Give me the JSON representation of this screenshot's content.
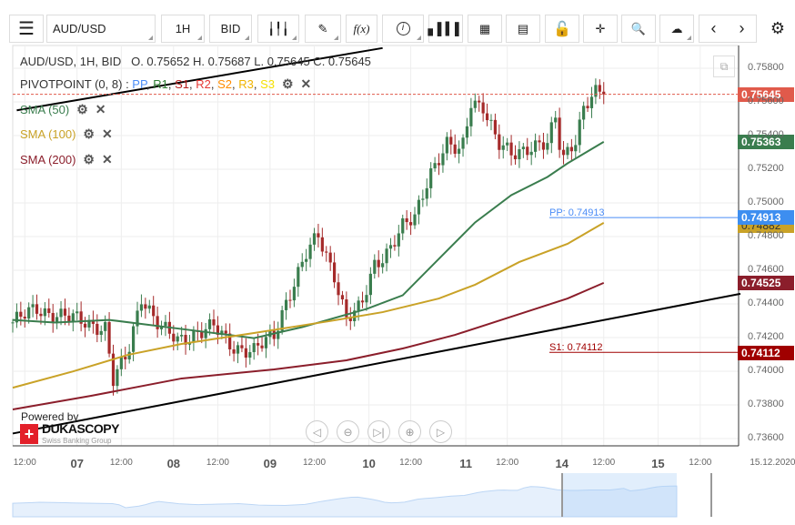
{
  "toolbar": {
    "menu_icon": "hamburger-icon",
    "instrument": "AUD/USD",
    "period": "1H",
    "side": "BID",
    "buttons": [
      "candles-icon",
      "pencil-icon",
      "function-icon",
      "info-icon",
      "volume-bars-icon",
      "calendar-icon",
      "report-icon",
      "lock-icon",
      "crosshair-icon",
      "zoom-chart-icon",
      "cloud-upload-icon",
      "prev-icon",
      "next-icon",
      "gear-icon"
    ],
    "fx_label": "f(x)"
  },
  "legend": {
    "ohlc": "AUD/USD, 1H, BID",
    "ohlc_values": "O. 0.75652 H. 0.75687 L. 0.75645 C. 0.75645",
    "pivot": "PIVOTPOINT (0, 8)",
    "pivot_colon": " : ",
    "pivot_items": [
      {
        "t": "PP",
        "c": "#4a8cf7"
      },
      {
        "t": "R1",
        "c": "#2e7d32"
      },
      {
        "t": "S1",
        "c": "#b71c1c"
      },
      {
        "t": "R2",
        "c": "#e53935"
      },
      {
        "t": "S2",
        "c": "#ff8c00"
      },
      {
        "t": "R3",
        "c": "#f0b400"
      },
      {
        "t": "S3",
        "c": "#f5e000"
      }
    ],
    "sma": [
      {
        "label": "SMA (50)",
        "color": "#3a7d4e"
      },
      {
        "label": "SMA (100)",
        "color": "#c9a227"
      },
      {
        "label": "SMA (200)",
        "color": "#8b1e2b"
      }
    ]
  },
  "price_labels": {
    "last": "0.75645",
    "sma50": "0.75363",
    "pp": "0.74913",
    "sma100": "0.74882",
    "sma200": "0.74525",
    "s1": "0.74112",
    "pp_line": "PP: 0.74913",
    "s1_line": "S1: 0.74112"
  },
  "branding": {
    "powered": "Powered by",
    "name": "DUKASCOPY",
    "sub": "Swiss Banking Group"
  },
  "nav_buttons": [
    "pan-left-icon",
    "zoom-out-icon",
    "go-latest-icon",
    "zoom-in-icon",
    "pan-right-icon"
  ],
  "chart_data": {
    "type": "candlestick",
    "title": "AUD/USD, 1H, BID",
    "ylim": [
      0.735,
      0.759
    ],
    "yticks": [
      "0.75800",
      "0.75600",
      "0.75400",
      "0.75200",
      "0.75000",
      "0.74800",
      "0.74600",
      "0.74400",
      "0.74200",
      "0.74000",
      "0.73800",
      "0.73600"
    ],
    "xticks": [
      {
        "h": 3,
        "l": "12:00",
        "day": false
      },
      {
        "h": 16,
        "l": "07",
        "day": true
      },
      {
        "h": 27,
        "l": "12:00",
        "day": false
      },
      {
        "h": 40,
        "l": "08",
        "day": true
      },
      {
        "h": 51,
        "l": "12:00",
        "day": false
      },
      {
        "h": 64,
        "l": "09",
        "day": true
      },
      {
        "h": 75,
        "l": "12:00",
        "day": false
      },
      {
        "h": 88.6,
        "l": "10",
        "day": true
      },
      {
        "h": 99,
        "l": "12:00",
        "day": false
      },
      {
        "h": 112.7,
        "l": "11",
        "day": true
      },
      {
        "h": 123,
        "l": "12:00",
        "day": false
      },
      {
        "h": 136.6,
        "l": "14",
        "day": true
      },
      {
        "h": 147,
        "l": "12:00",
        "day": false
      },
      {
        "h": 160.5,
        "l": "15",
        "day": true
      },
      {
        "h": 171,
        "l": "12:00",
        "day": false
      },
      {
        "h": 189,
        "l": "15.12.2020",
        "day": false
      }
    ],
    "close_waypoints": [
      [
        0,
        0.7429
      ],
      [
        6,
        0.7437
      ],
      [
        15,
        0.7431
      ],
      [
        23,
        0.7426
      ],
      [
        25,
        0.7394
      ],
      [
        28.6,
        0.741
      ],
      [
        32,
        0.7445
      ],
      [
        36.6,
        0.7426
      ],
      [
        41,
        0.7418
      ],
      [
        45.5,
        0.7423
      ],
      [
        50,
        0.7426
      ],
      [
        54.5,
        0.7415
      ],
      [
        60,
        0.7412
      ],
      [
        65,
        0.7421
      ],
      [
        68,
        0.7442
      ],
      [
        73,
        0.7469
      ],
      [
        76,
        0.748
      ],
      [
        80,
        0.7458
      ],
      [
        83,
        0.7431
      ],
      [
        86.6,
        0.7437
      ],
      [
        90,
        0.7464
      ],
      [
        93.4,
        0.7472
      ],
      [
        97,
        0.7485
      ],
      [
        100,
        0.7491
      ],
      [
        103.6,
        0.7518
      ],
      [
        108,
        0.7534
      ],
      [
        111.6,
        0.7529
      ],
      [
        114,
        0.7561
      ],
      [
        117,
        0.7558
      ],
      [
        120.7,
        0.7534
      ],
      [
        124,
        0.7529
      ],
      [
        128.6,
        0.7534
      ],
      [
        133,
        0.7534
      ],
      [
        135,
        0.755
      ],
      [
        136.6,
        0.7526
      ],
      [
        140,
        0.7539
      ],
      [
        142,
        0.7556
      ],
      [
        144.5,
        0.7564
      ],
      [
        147,
        0.75645
      ]
    ],
    "sma50": [
      [
        0,
        0.74305
      ],
      [
        10.5,
        0.74289
      ],
      [
        24,
        0.74305
      ],
      [
        42,
        0.74251
      ],
      [
        60,
        0.74197
      ],
      [
        72,
        0.74262
      ],
      [
        88,
        0.7437
      ],
      [
        97,
        0.74451
      ],
      [
        106,
        0.74668
      ],
      [
        115,
        0.74884
      ],
      [
        124,
        0.75046
      ],
      [
        133,
        0.75154
      ],
      [
        138,
        0.75235
      ],
      [
        147,
        0.75363
      ]
    ],
    "sma100": [
      [
        0,
        0.73902
      ],
      [
        15,
        0.73999
      ],
      [
        28.6,
        0.74097
      ],
      [
        42,
        0.74162
      ],
      [
        60,
        0.74227
      ],
      [
        78.6,
        0.74297
      ],
      [
        92,
        0.74351
      ],
      [
        106,
        0.74432
      ],
      [
        115,
        0.74514
      ],
      [
        126,
        0.74649
      ],
      [
        138,
        0.74757
      ],
      [
        147,
        0.74882
      ]
    ],
    "sma200": [
      [
        0,
        0.73773
      ],
      [
        19.5,
        0.73854
      ],
      [
        42,
        0.73957
      ],
      [
        65,
        0.74011
      ],
      [
        83,
        0.74065
      ],
      [
        97,
        0.74135
      ],
      [
        110,
        0.74216
      ],
      [
        124,
        0.74324
      ],
      [
        138,
        0.74432
      ],
      [
        147,
        0.74525
      ]
    ],
    "trendlines": [
      [
        [
          0,
          0.7363
        ],
        [
          181,
          0.7446
        ]
      ],
      [
        [
          1,
          0.7555
        ],
        [
          92,
          0.7592
        ]
      ]
    ],
    "pivot_pp": 0.74913,
    "pivot_s1": 0.74112,
    "last": 0.75645
  }
}
